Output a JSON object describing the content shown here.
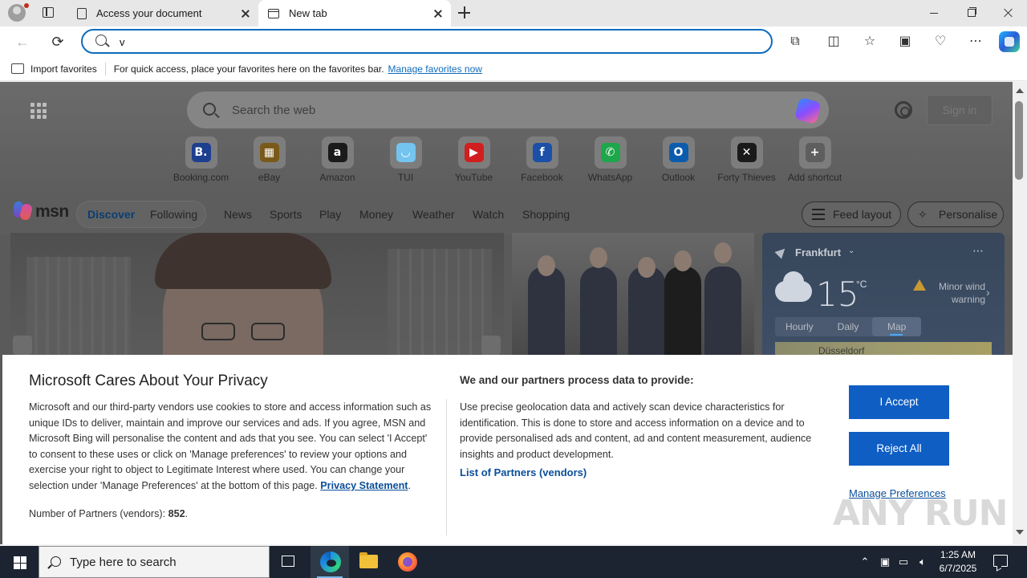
{
  "browser": {
    "tabs": [
      {
        "title": "Access your document",
        "active": false
      },
      {
        "title": "New tab",
        "active": true
      }
    ],
    "address_value": "v",
    "icons": [
      "profile-icon",
      "tab-actions-icon",
      "document-icon",
      "new-tab-icon",
      "close-icon",
      "back-icon",
      "refresh-icon",
      "search-icon",
      "extensions-icon",
      "split-screen-icon",
      "favorites-icon",
      "collections-icon",
      "browser-essentials-icon",
      "more-icon",
      "copilot-icon"
    ]
  },
  "favorites_bar": {
    "import_label": "Import favorites",
    "message": "For quick access, place your favorites here on the favorites bar.",
    "manage_link": "Manage favorites now"
  },
  "newtab": {
    "search_placeholder": "Search the web",
    "signin_label": "Sign in",
    "shortcuts": [
      {
        "label": "Booking.com",
        "glyph": "B.",
        "color": "#1d3f8f"
      },
      {
        "label": "eBay",
        "glyph": "▦",
        "color": "#7a5a1a"
      },
      {
        "label": "Amazon",
        "glyph": "a",
        "color": "#1a1a1a"
      },
      {
        "label": "TUI",
        "glyph": "◡",
        "color": "#73c4ef"
      },
      {
        "label": "YouTube",
        "glyph": "▶",
        "color": "#d11e1e"
      },
      {
        "label": "Facebook",
        "glyph": "f",
        "color": "#1b4fa8"
      },
      {
        "label": "WhatsApp",
        "glyph": "✆",
        "color": "#1ea64a"
      },
      {
        "label": "Outlook",
        "glyph": "O",
        "color": "#0b5cad"
      },
      {
        "label": "Forty Thieves",
        "glyph": "✕",
        "color": "#1a1a1a"
      },
      {
        "label": "Add shortcut",
        "glyph": "+",
        "color": "#5e5e5e"
      }
    ]
  },
  "msn": {
    "logo_text": "msn",
    "tab_discover": "Discover",
    "tab_following": "Following",
    "nav": [
      "News",
      "Sports",
      "Play",
      "Money",
      "Weather",
      "Watch",
      "Shopping"
    ],
    "feed_layout": "Feed layout",
    "personalise": "Personalise"
  },
  "weather": {
    "location": "Frankfurt",
    "temperature": "15",
    "unit": "°C",
    "warning": "Minor wind warning",
    "tabs": [
      "Hourly",
      "Daily",
      "Map"
    ],
    "selected_tab": "Map",
    "map_label": "Düsseldorf"
  },
  "privacy": {
    "title": "Microsoft Cares About Your Privacy",
    "body": "Microsoft and our third-party vendors use cookies to store and access information such as unique IDs to deliver, maintain and improve our services and ads. If you agree, MSN and Microsoft Bing will personalise the content and ads that you see. You can select 'I Accept' to consent to these uses or click on 'Manage preferences' to review your options and exercise your right to object to Legitimate Interest where used.  You can change your selection under 'Manage Preferences' at the bottom of this page.",
    "privacy_link": "Privacy Statement",
    "partners_label": "Number of Partners (vendors):",
    "partners_count": "852",
    "right_title": "We and our partners process data to provide:",
    "right_body": "Use precise geolocation data and actively scan device characteristics for identification. This is done to store and access information on a device and to provide personalised ads and content, ad and content measurement, audience insights and product development.",
    "vendors_link": "List of Partners (vendors)",
    "accept": "I Accept",
    "reject": "Reject All",
    "manage": "Manage Preferences"
  },
  "watermark": "ANY RUN",
  "taskbar": {
    "search_placeholder": "Type here to search",
    "time": "1:25 AM",
    "date": "6/7/2025",
    "apps": [
      "task-view",
      "edge",
      "file-explorer",
      "firefox"
    ]
  }
}
